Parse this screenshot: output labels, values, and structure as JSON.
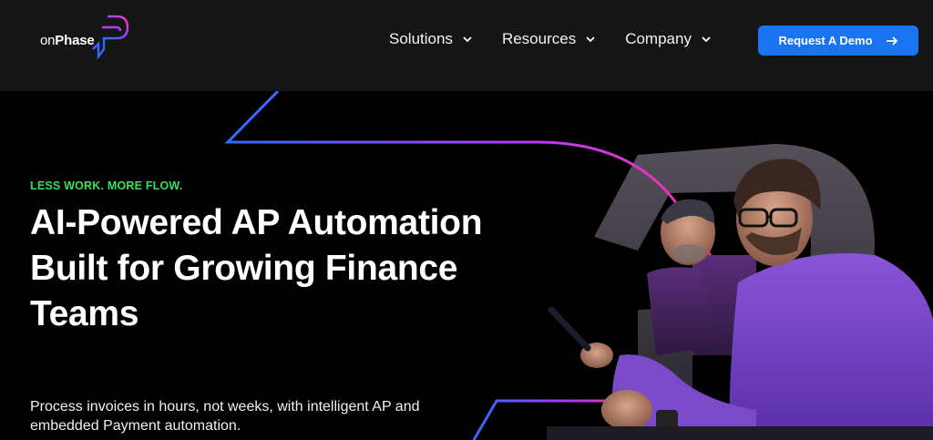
{
  "brand": {
    "prefix": "on",
    "name": "Phase",
    "colors": {
      "blue": "#1a73f0",
      "purple": "#a93cff",
      "pink": "#ff2fa0"
    }
  },
  "nav": {
    "items": [
      {
        "label": "Solutions",
        "icon": "chevron-down-icon"
      },
      {
        "label": "Resources",
        "icon": "chevron-down-icon"
      },
      {
        "label": "Company",
        "icon": "chevron-down-icon"
      }
    ],
    "cta": {
      "label": "Request A Demo",
      "icon": "arrow-right-icon"
    }
  },
  "hero": {
    "eyebrow": "LESS WORK. MORE FLOW.",
    "headline": "AI-Powered AP Automation Built for Growing Finance Teams",
    "subtext": "Process invoices in hours, not weeks, with intelligent AP and embedded Payment automation.",
    "image": "two-men-in-meeting-photo"
  }
}
